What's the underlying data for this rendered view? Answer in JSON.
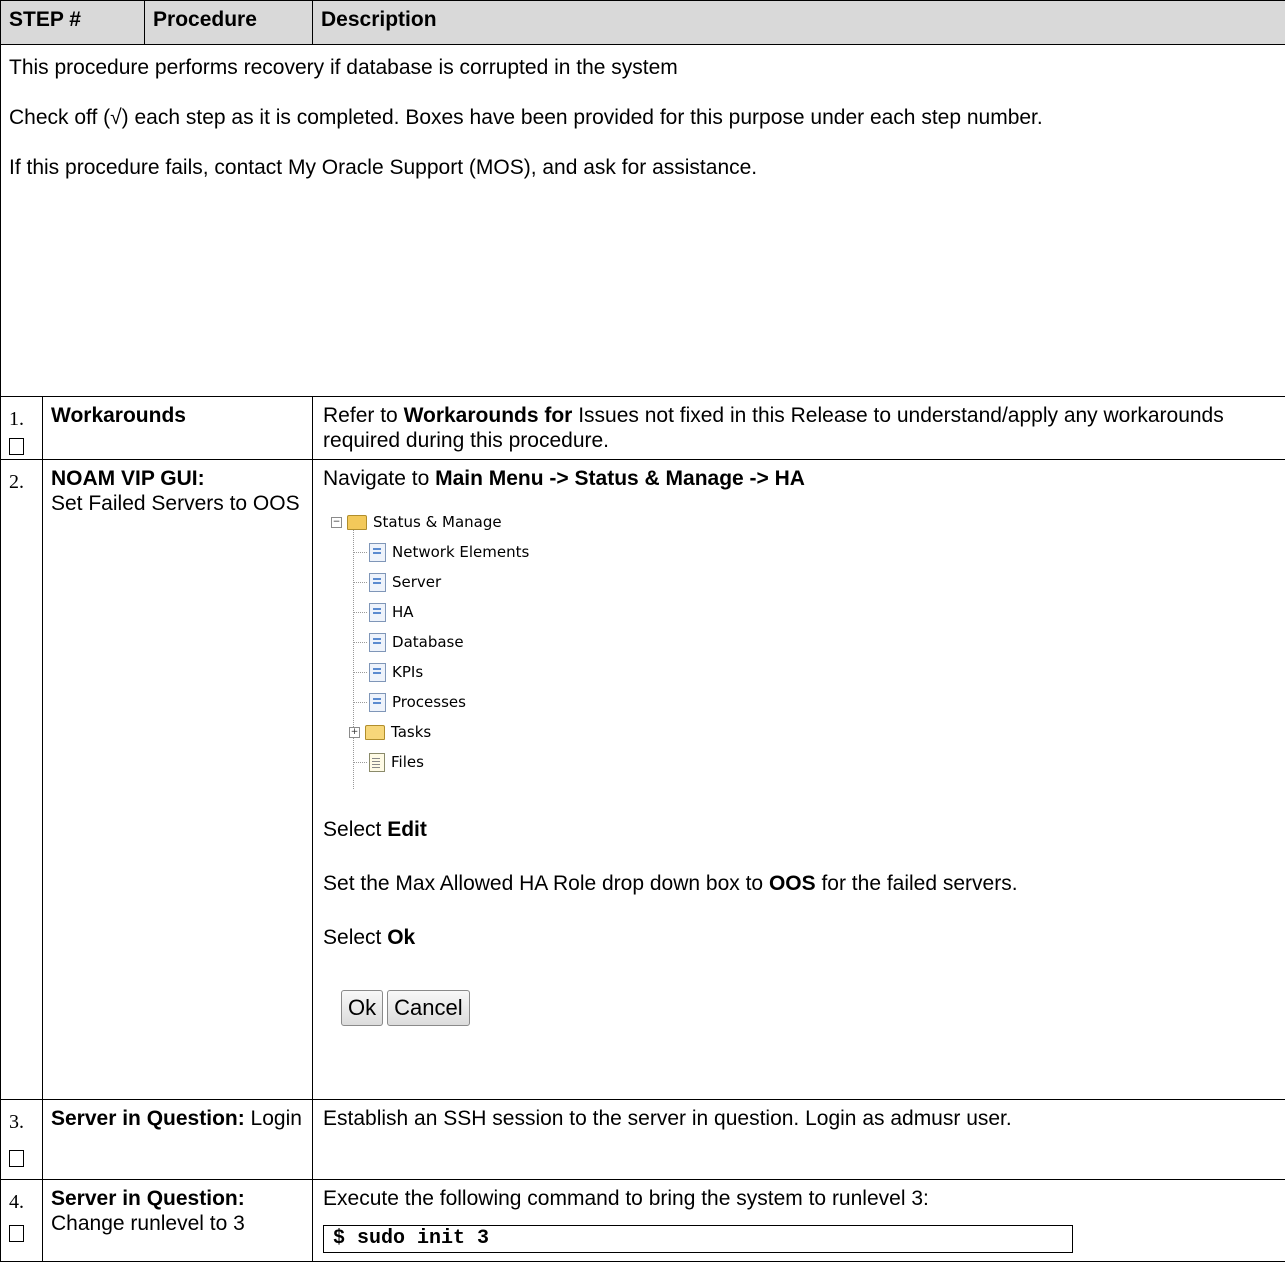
{
  "header": {
    "step": "STEP #",
    "procedure": "Procedure",
    "description": "Description"
  },
  "intro": {
    "line1": "This procedure performs recovery if database is corrupted in the system",
    "line2": "Check off (√) each step as it is completed. Boxes have been provided for this purpose under each step number.",
    "line3": "If this procedure fails, contact My Oracle Support (MOS), and ask for assistance."
  },
  "steps": [
    {
      "num": "1.",
      "procedure_bold": "Workarounds",
      "procedure_rest": "",
      "desc": {
        "pre": "Refer to ",
        "bold": "Workarounds for",
        "post": " Issues not fixed in this Release to understand/apply any workarounds required during this procedure."
      }
    },
    {
      "num": "2.",
      "procedure_bold": "NOAM VIP GUI:",
      "procedure_rest": "Set Failed Servers to OOS",
      "nav_pre": "Navigate to ",
      "nav_bold": "Main Menu -> Status & Manage -> HA",
      "tree": {
        "root": "Status & Manage",
        "items": [
          "Network Elements",
          "Server",
          "HA",
          "Database",
          "KPIs",
          "Processes"
        ],
        "folder": "Tasks",
        "file": "Files"
      },
      "select_edit_pre": "Select ",
      "select_edit_bold": "Edit",
      "set_pre": "Set the Max Allowed HA Role drop down box to ",
      "set_bold": "OOS",
      "set_post": " for the failed servers.",
      "select_ok_pre": "Select ",
      "select_ok_bold": "Ok",
      "buttons": {
        "ok": "Ok",
        "cancel": "Cancel"
      }
    },
    {
      "num": "3.",
      "procedure_bold": "Server in Question:",
      "procedure_rest": " Login",
      "desc": "Establish an SSH session to the server in question. Login as admusr user."
    },
    {
      "num": "4.",
      "procedure_bold": "Server in Question:",
      "procedure_rest": "Change runlevel to 3",
      "desc": "Execute the following command to bring the system to runlevel 3:",
      "command": "$ sudo init 3"
    }
  ]
}
